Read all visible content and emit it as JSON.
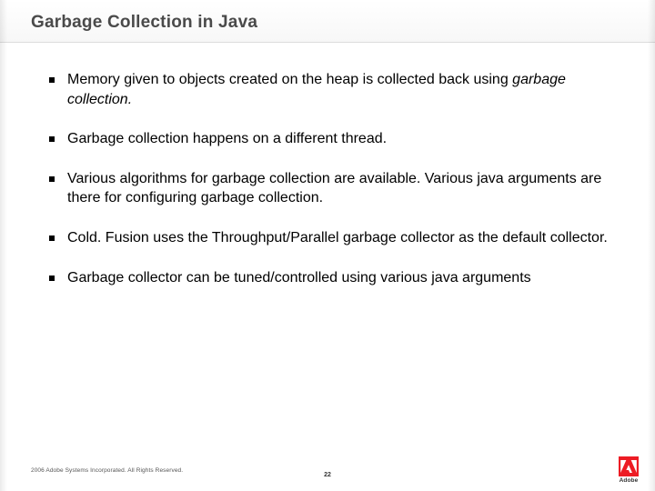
{
  "title": "Garbage Collection in Java",
  "bullets": [
    {
      "pre": "Memory given to objects created on the heap is collected back using ",
      "em": "garbage collection.",
      "post": ""
    },
    {
      "pre": "Garbage collection happens on a different thread.",
      "em": "",
      "post": ""
    },
    {
      "pre": "Various algorithms for garbage collection are available.   Various java arguments are there for configuring garbage collection.",
      "em": "",
      "post": ""
    },
    {
      "pre": "Cold. Fusion uses the Throughput/Parallel garbage collector as the default collector.",
      "em": "",
      "post": ""
    },
    {
      "pre": "Garbage collector can be tuned/controlled using various java arguments",
      "em": "",
      "post": ""
    }
  ],
  "footer": {
    "copyright": "2006 Adobe Systems Incorporated. All Rights Reserved.",
    "page_number": "22",
    "logo_label": "Adobe"
  }
}
